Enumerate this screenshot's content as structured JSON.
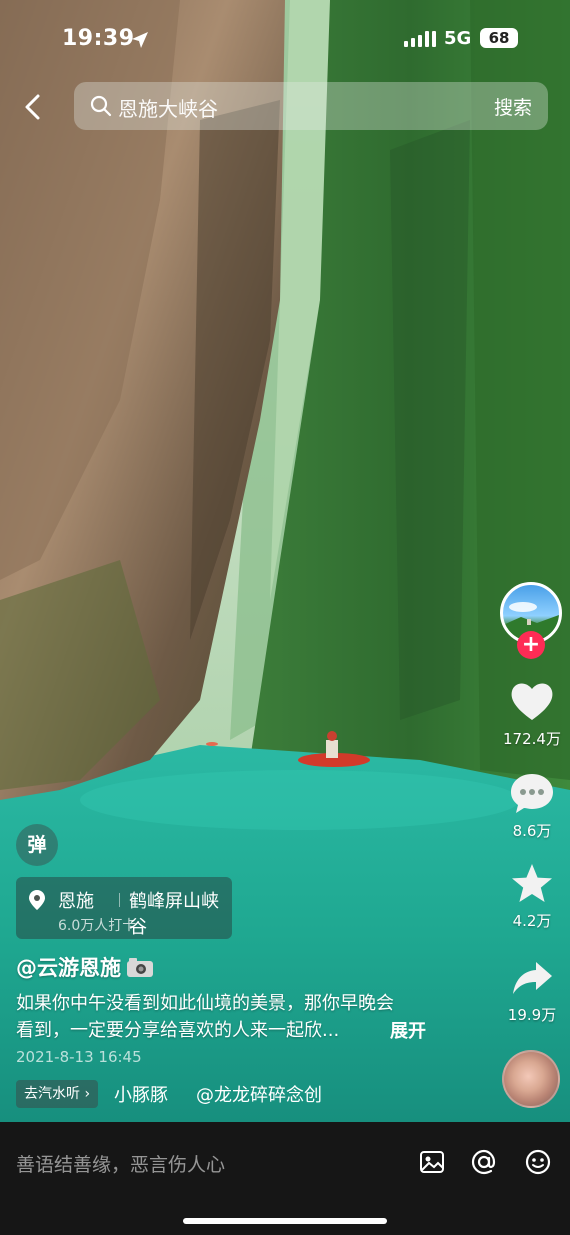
{
  "status_bar": {
    "time": "19:39",
    "network": "5G",
    "battery": "68"
  },
  "search": {
    "query": "恩施大峡谷",
    "submit_label": "搜索"
  },
  "rail": {
    "likes": "172.4万",
    "comments": "8.6万",
    "favorites": "4.2万",
    "shares": "19.9万",
    "follow_symbol": "+"
  },
  "danmu_label": "弹",
  "poi": {
    "city": "恩施",
    "name": "鹤峰屏山峡谷",
    "checkins": "6.0万人打卡"
  },
  "post": {
    "author": "@云游恩施",
    "caption_line1": "如果你中午没看到如此仙境的美景，那你早晚会",
    "caption_line2": "看到，一定要分享给喜欢的人来一起欣...",
    "expand_label": "展开",
    "date": "2021-8-13 16:45"
  },
  "tags": {
    "chip": "去汽水听 ›",
    "song": "小豚豚",
    "mention": "@龙龙碎碎念创"
  },
  "comment_bar": {
    "placeholder": "善语结善缘，恶言伤人心"
  },
  "icons": [
    "location-arrow-icon",
    "signal-icon",
    "back-icon",
    "search-icon",
    "heart-icon",
    "comment-icon",
    "star-icon",
    "share-icon",
    "pin-icon",
    "camera-icon",
    "image-icon",
    "at-icon",
    "emoji-icon"
  ]
}
